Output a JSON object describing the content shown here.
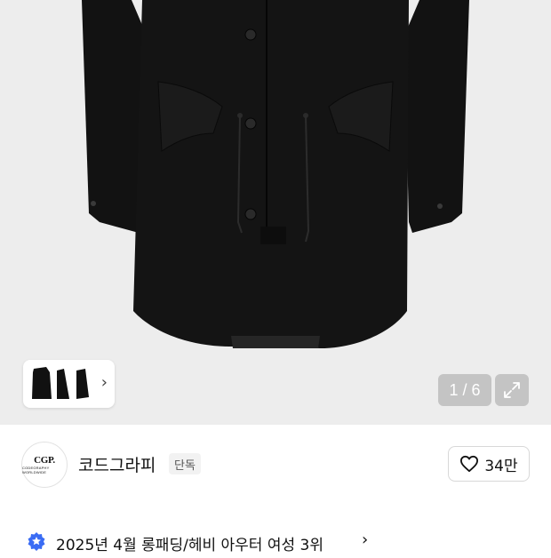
{
  "gallery": {
    "counter": "1 / 6",
    "current": 1,
    "total": 6
  },
  "brand": {
    "logo_line1": "CGP.",
    "logo_line2": "CODEGRAPHY WORLDWIDE",
    "name": "코드그라피",
    "badge": "단독",
    "like_count": "34만"
  },
  "ranking": {
    "text": "2025년 4월 롱패딩/헤비 아우터 여성 3위",
    "chevron": "›"
  },
  "icons": {
    "thumb_chevron": "›",
    "expand": "expand-icon",
    "heart": "heart-icon",
    "star_badge": "star-badge-icon"
  },
  "colors": {
    "hero_bg": "#ededed",
    "rank_icon": "#3a6cf4",
    "coat": "#111111"
  }
}
